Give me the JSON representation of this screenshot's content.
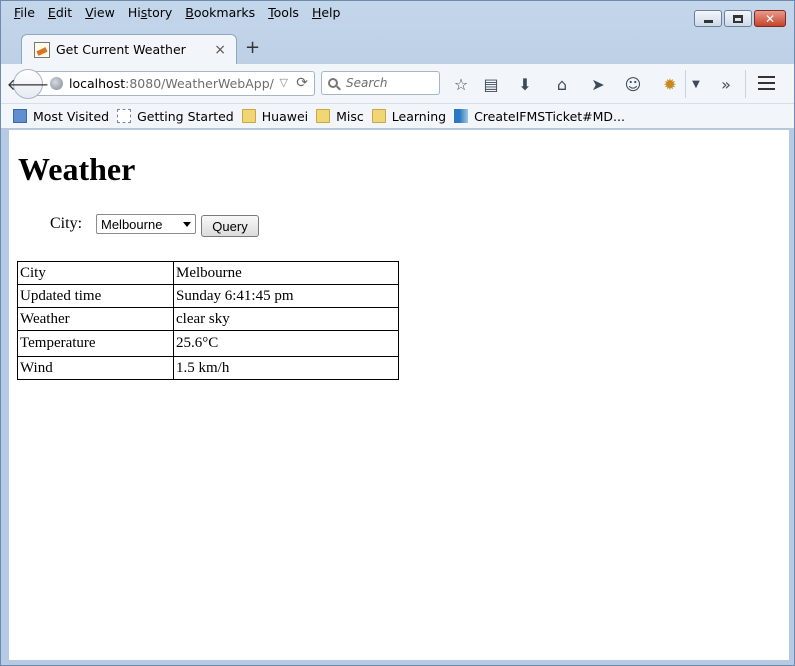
{
  "menu": [
    {
      "mnemonic": "F",
      "rest": "ile"
    },
    {
      "mnemonic": "E",
      "rest": "dit"
    },
    {
      "mnemonic": "V",
      "rest": "iew"
    },
    {
      "mnemonic": "",
      "pre": "Hi",
      "mn2": "s",
      "rest": "tory"
    },
    {
      "mnemonic": "B",
      "rest": "ookmarks"
    },
    {
      "mnemonic": "T",
      "rest": "ools"
    },
    {
      "mnemonic": "H",
      "rest": "elp"
    }
  ],
  "menu_labels": [
    "File",
    "Edit",
    "View",
    "History",
    "Bookmarks",
    "Tools",
    "Help"
  ],
  "tab": {
    "title": "Get Current Weather",
    "close": "×",
    "new_tab": "+"
  },
  "url": {
    "host": "localhost",
    "rest": ":8080/WeatherWebApp/"
  },
  "search": {
    "placeholder": "Search"
  },
  "bookmarks": [
    {
      "label": "Most Visited",
      "icon": "most-visited-icon"
    },
    {
      "label": "Getting Started",
      "icon": "page-icon"
    },
    {
      "label": "Huawei",
      "icon": "folder-icon"
    },
    {
      "label": "Misc",
      "icon": "folder-icon"
    },
    {
      "label": "Learning",
      "icon": "folder-icon"
    },
    {
      "label": "CreateIFMSTicket#MD...",
      "icon": "ticket-icon"
    }
  ],
  "page": {
    "heading": "Weather",
    "city_label": "City:",
    "city_selected": "Melbourne",
    "query_button": "Query"
  },
  "weather_table": {
    "rows": [
      {
        "key": "City",
        "value": "Melbourne"
      },
      {
        "key": "Updated time",
        "value": "Sunday 6:41:45 pm"
      },
      {
        "key": "Weather",
        "value": "clear sky"
      },
      {
        "key": "Temperature",
        "value": "25.6°C"
      },
      {
        "key": "Wind",
        "value": "1.5 km/h"
      }
    ]
  }
}
